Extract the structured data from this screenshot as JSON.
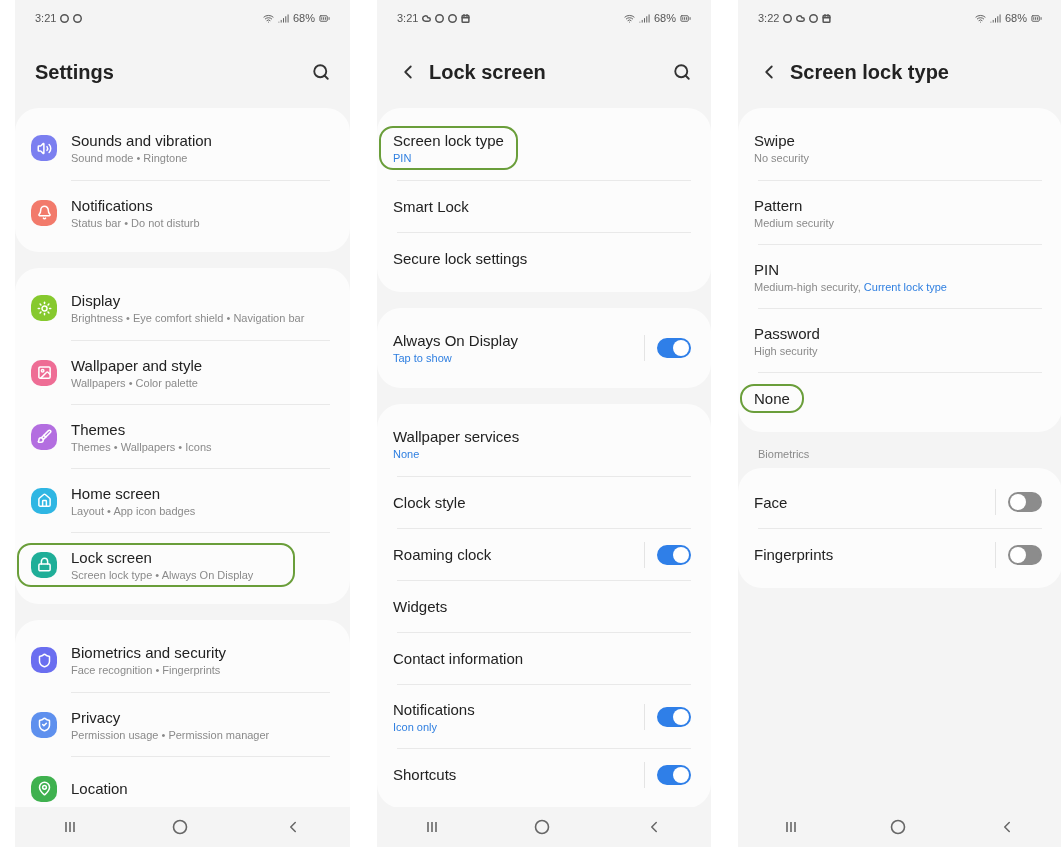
{
  "screens": [
    {
      "kind": "menu",
      "status_bar": {
        "time": "3:21",
        "notification_icons": [
          {
            "kind": "circle"
          },
          {
            "kind": "circle"
          }
        ],
        "battery": "68%"
      },
      "header": {
        "title": "Settings",
        "back": false,
        "search": true
      },
      "groups": [
        {
          "items": [
            {
              "title": "Sounds and vibration",
              "subtitle": "Sound mode  •  Ringtone",
              "color": "#7b7ff0",
              "highlighted": false
            },
            {
              "title": "Notifications",
              "subtitle": "Status bar  •  Do not disturb",
              "color": "#f27a6b",
              "highlighted": false
            }
          ]
        },
        {
          "items": [
            {
              "title": "Display",
              "subtitle": "Brightness  •  Eye comfort shield  •  Navigation bar",
              "color": "#86c92e",
              "highlighted": false
            },
            {
              "title": "Wallpaper and style",
              "subtitle": "Wallpapers  •  Color palette",
              "color": "#ee6d95",
              "highlighted": false
            },
            {
              "title": "Themes",
              "subtitle": "Themes  •  Wallpapers  •  Icons",
              "color": "#b36ee0",
              "highlighted": false
            },
            {
              "title": "Home screen",
              "subtitle": "Layout  •  App icon badges",
              "color": "#2fb6e3",
              "highlighted": false
            },
            {
              "title": "Lock screen",
              "subtitle": "Screen lock type  •  Always On Display",
              "color": "#1fae98",
              "highlighted": true
            }
          ]
        },
        {
          "items": [
            {
              "title": "Biometrics and security",
              "subtitle": "Face recognition  •  Fingerprints",
              "color": "#6a6ef0",
              "highlighted": false
            },
            {
              "title": "Privacy",
              "subtitle": "Permission usage  •  Permission manager",
              "color": "#5e90ee",
              "highlighted": false
            },
            {
              "title": "Location",
              "color": "#3fb14f",
              "highlighted": false
            }
          ]
        }
      ]
    },
    {
      "kind": "list",
      "status_bar": {
        "time": "3:21",
        "notification_icons": [
          {
            "kind": "cloud"
          },
          {
            "kind": "circle"
          },
          {
            "kind": "circle"
          },
          {
            "kind": "calendar"
          }
        ],
        "battery": "68%"
      },
      "header": {
        "title": "Lock screen",
        "back": true,
        "search": true
      },
      "groups": [
        {
          "items": [
            {
              "title": "Screen lock type",
              "subtitle": "PIN",
              "accent": true,
              "highlighted": true
            },
            {
              "title": "Smart Lock",
              "highlighted": false
            },
            {
              "title": "Secure lock settings",
              "highlighted": false
            }
          ]
        },
        {
          "items": [
            {
              "title": "Always On Display",
              "subtitle": "Tap to show",
              "accent": true,
              "highlighted": false,
              "kind": "switch",
              "on": true
            }
          ]
        },
        {
          "items": [
            {
              "title": "Wallpaper services",
              "subtitle": "None",
              "accent": true,
              "highlighted": false
            },
            {
              "title": "Clock style",
              "highlighted": false
            },
            {
              "title": "Roaming clock",
              "highlighted": false,
              "kind": "switch",
              "on": true
            },
            {
              "title": "Widgets",
              "highlighted": false
            },
            {
              "title": "Contact information",
              "highlighted": false
            },
            {
              "title": "Notifications",
              "subtitle": "Icon only",
              "accent": true,
              "highlighted": false,
              "kind": "switch",
              "on": true
            },
            {
              "title": "Shortcuts",
              "highlighted": false,
              "kind": "switch",
              "on": true
            }
          ]
        }
      ]
    },
    {
      "kind": "list",
      "status_bar": {
        "time": "3:22",
        "notification_icons": [
          {
            "kind": "circle"
          },
          {
            "kind": "cloud"
          },
          {
            "kind": "circle"
          },
          {
            "kind": "calendar"
          }
        ],
        "battery": "68%"
      },
      "header": {
        "title": "Screen lock type",
        "back": true,
        "search": false
      },
      "groups": [
        {
          "items": [
            {
              "title": "Swipe",
              "subtitle": "No security",
              "accent": false,
              "highlighted": false
            },
            {
              "title": "Pattern",
              "subtitle": "Medium security",
              "accent": false,
              "highlighted": false
            },
            {
              "title": "PIN",
              "subtitle": "Medium-high security,",
              "note": "Current lock type",
              "accent": false,
              "highlighted": false
            },
            {
              "title": "Password",
              "subtitle": "High security",
              "accent": false,
              "highlighted": false
            },
            {
              "title": "None",
              "highlighted": true
            }
          ]
        },
        {
          "label": "Biometrics",
          "items": [
            {
              "title": "Face",
              "highlighted": false,
              "kind": "switch",
              "on": false
            },
            {
              "title": "Fingerprints",
              "highlighted": false,
              "kind": "switch",
              "on": false
            }
          ]
        }
      ]
    }
  ]
}
